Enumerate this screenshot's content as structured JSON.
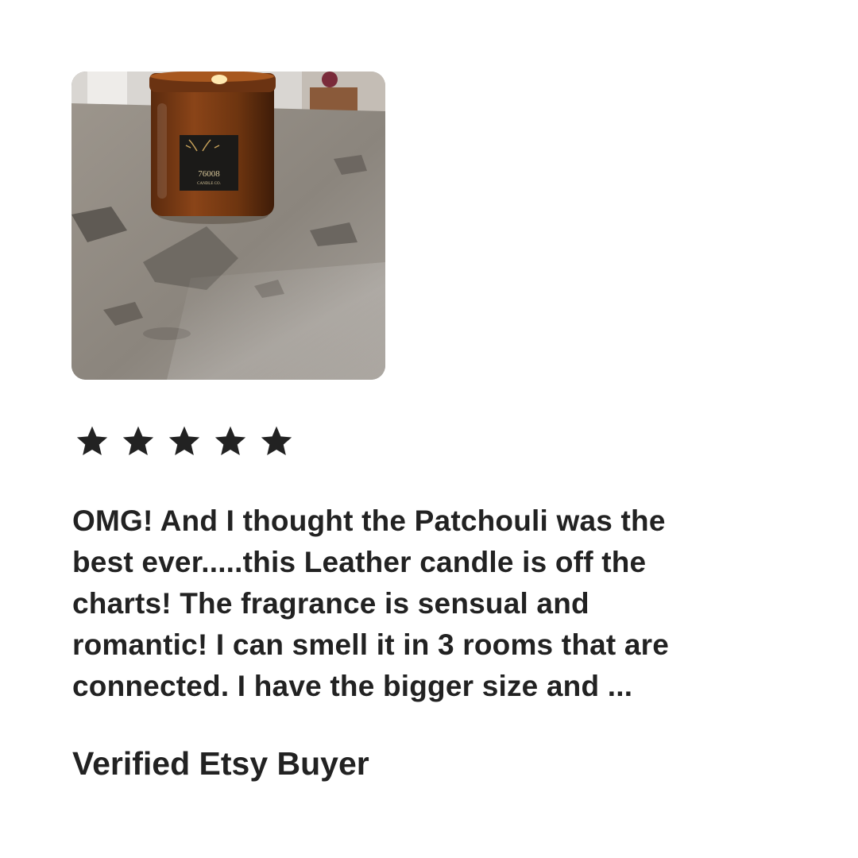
{
  "review": {
    "rating": 5,
    "rating_max": 5,
    "star_color": "#222222",
    "text": "OMG! And I thought the Patchouli was the\nbest ever.....this Leather candle is off the\ncharts!  The fragrance is sensual and\nromantic!  I can smell it in 3 rooms that are\nconnected. I have the bigger size and ...",
    "reviewer": "Verified Etsy Buyer"
  },
  "photo": {
    "label_brand": "76008",
    "label_sub": "CANDLE CO."
  }
}
